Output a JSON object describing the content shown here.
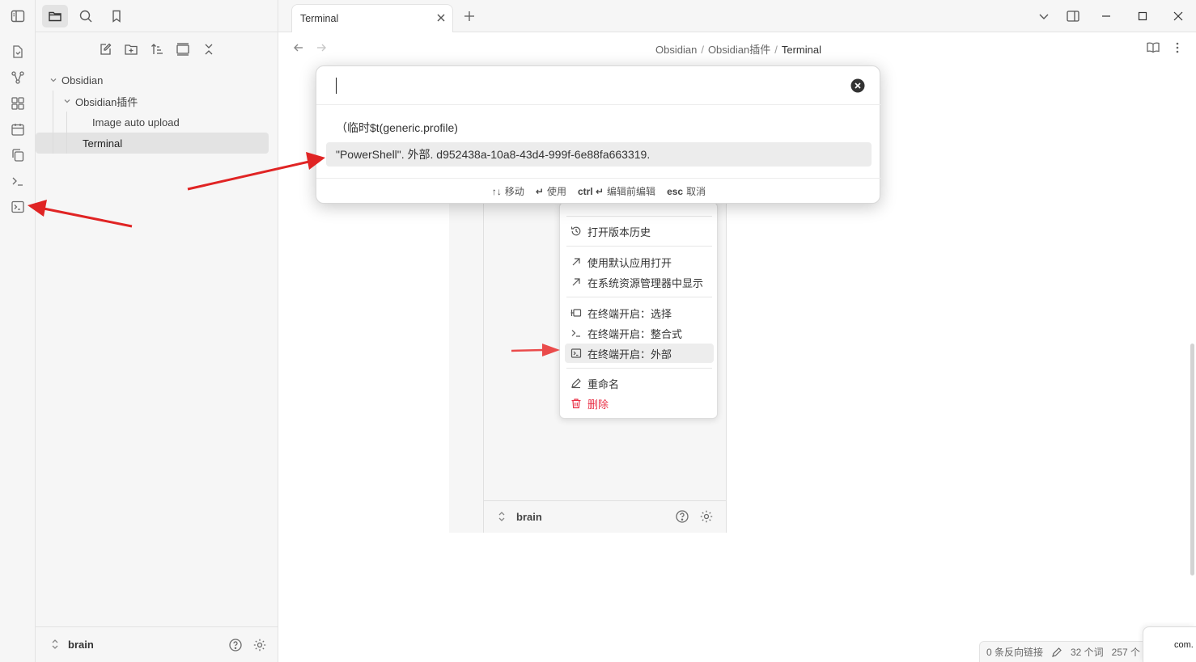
{
  "colors": {
    "accent_arrow": "#e02424",
    "danger": "#e93147",
    "selected_bg": "#ececec"
  },
  "tab": {
    "title": "Terminal"
  },
  "breadcrumb": {
    "part1": "Obsidian",
    "part2": "Obsidian插件",
    "current": "Terminal",
    "separator": "/"
  },
  "explorer": {
    "tree": [
      {
        "label": "Obsidian",
        "level": 0,
        "type": "folder"
      },
      {
        "label": "Obsidian插件",
        "level": 1,
        "type": "folder"
      },
      {
        "label": "Image auto upload",
        "level": 2,
        "type": "file"
      },
      {
        "label": "Terminal",
        "level": 2,
        "type": "file",
        "active": true
      }
    ],
    "vault_name": "brain"
  },
  "modal": {
    "input_value": "",
    "suggestions": [
      {
        "label": "（临时$t(generic.profile)"
      },
      {
        "label": "\"PowerShell\". 外部. d952438a-10a8-43d4-999f-6e88fa663319."
      }
    ],
    "instructions": [
      {
        "key": "↑↓",
        "text": "移动"
      },
      {
        "key": "↵",
        "text": "使用"
      },
      {
        "key": "ctrl ↵",
        "text": "编辑前编辑"
      },
      {
        "key": "esc",
        "text": "取消"
      }
    ]
  },
  "context_menu": {
    "items": [
      {
        "label": "打开版本历史",
        "icon": "history-icon"
      },
      {
        "label": "使用默认应用打开",
        "icon": "arrow-up-right-icon"
      },
      {
        "label": "在系统资源管理器中显示",
        "icon": "arrow-up-right-icon"
      },
      {
        "label": "在终端开启：选择",
        "icon": "terminal-select-icon"
      },
      {
        "label": "在终端开启：整合式",
        "icon": "terminal-prompt-icon"
      },
      {
        "label": "在终端开启：外部",
        "icon": "terminal-square-icon"
      },
      {
        "label": "重命名",
        "icon": "pencil-icon"
      },
      {
        "label": "删除",
        "icon": "trash-icon"
      }
    ]
  },
  "embedded_vault_name": "brain",
  "status_bar": {
    "backlinks": "0 条反向链接",
    "words": "32 个词",
    "chars": "257 个"
  },
  "notice": {
    "text": "com."
  }
}
